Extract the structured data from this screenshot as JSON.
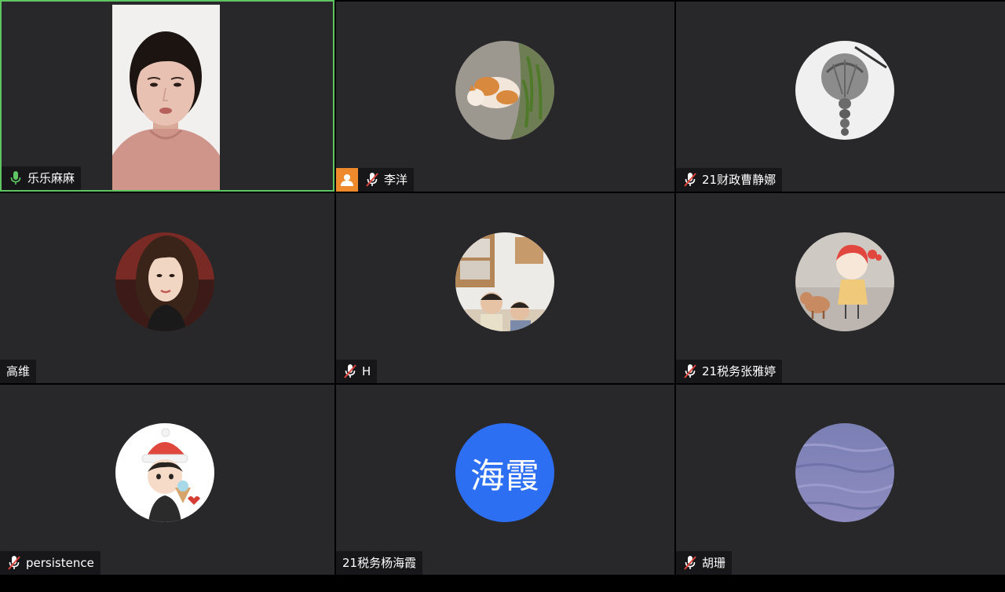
{
  "participants": [
    {
      "name": "乐乐麻麻",
      "mic": "on",
      "video": "on",
      "active_speaker": true
    },
    {
      "name": "李洋",
      "mic": "muted",
      "video": "off",
      "host_badge": true,
      "avatar_icon": "cat-avatar"
    },
    {
      "name": "21财政曹静娜",
      "mic": "muted",
      "video": "off",
      "avatar_icon": "braid-sketch-avatar"
    },
    {
      "name": "高维",
      "mic": "none",
      "video": "off",
      "avatar_icon": "woman-portrait-avatar"
    },
    {
      "name": "H",
      "mic": "muted",
      "video": "off",
      "avatar_icon": "kids-photo-avatar"
    },
    {
      "name": "21税务张雅婷",
      "mic": "muted",
      "video": "off",
      "avatar_icon": "cartoon-girl-dog-avatar"
    },
    {
      "name": "persistence",
      "mic": "muted",
      "video": "off",
      "avatar_icon": "cartoon-boy-santa-hat-avatar"
    },
    {
      "name": "21税务杨海霞",
      "mic": "none",
      "video": "off",
      "initials": "海霞",
      "initials_color": "#2d6ff2"
    },
    {
      "name": "胡珊",
      "mic": "muted",
      "video": "off",
      "avatar_icon": "water-texture-avatar"
    }
  ],
  "colors": {
    "tile_bg": "#28282b",
    "active_border": "#5ec562",
    "mic_on": "#5ec562",
    "mic_muted": "#e0433b",
    "host_badge": "#ef8a2c"
  }
}
